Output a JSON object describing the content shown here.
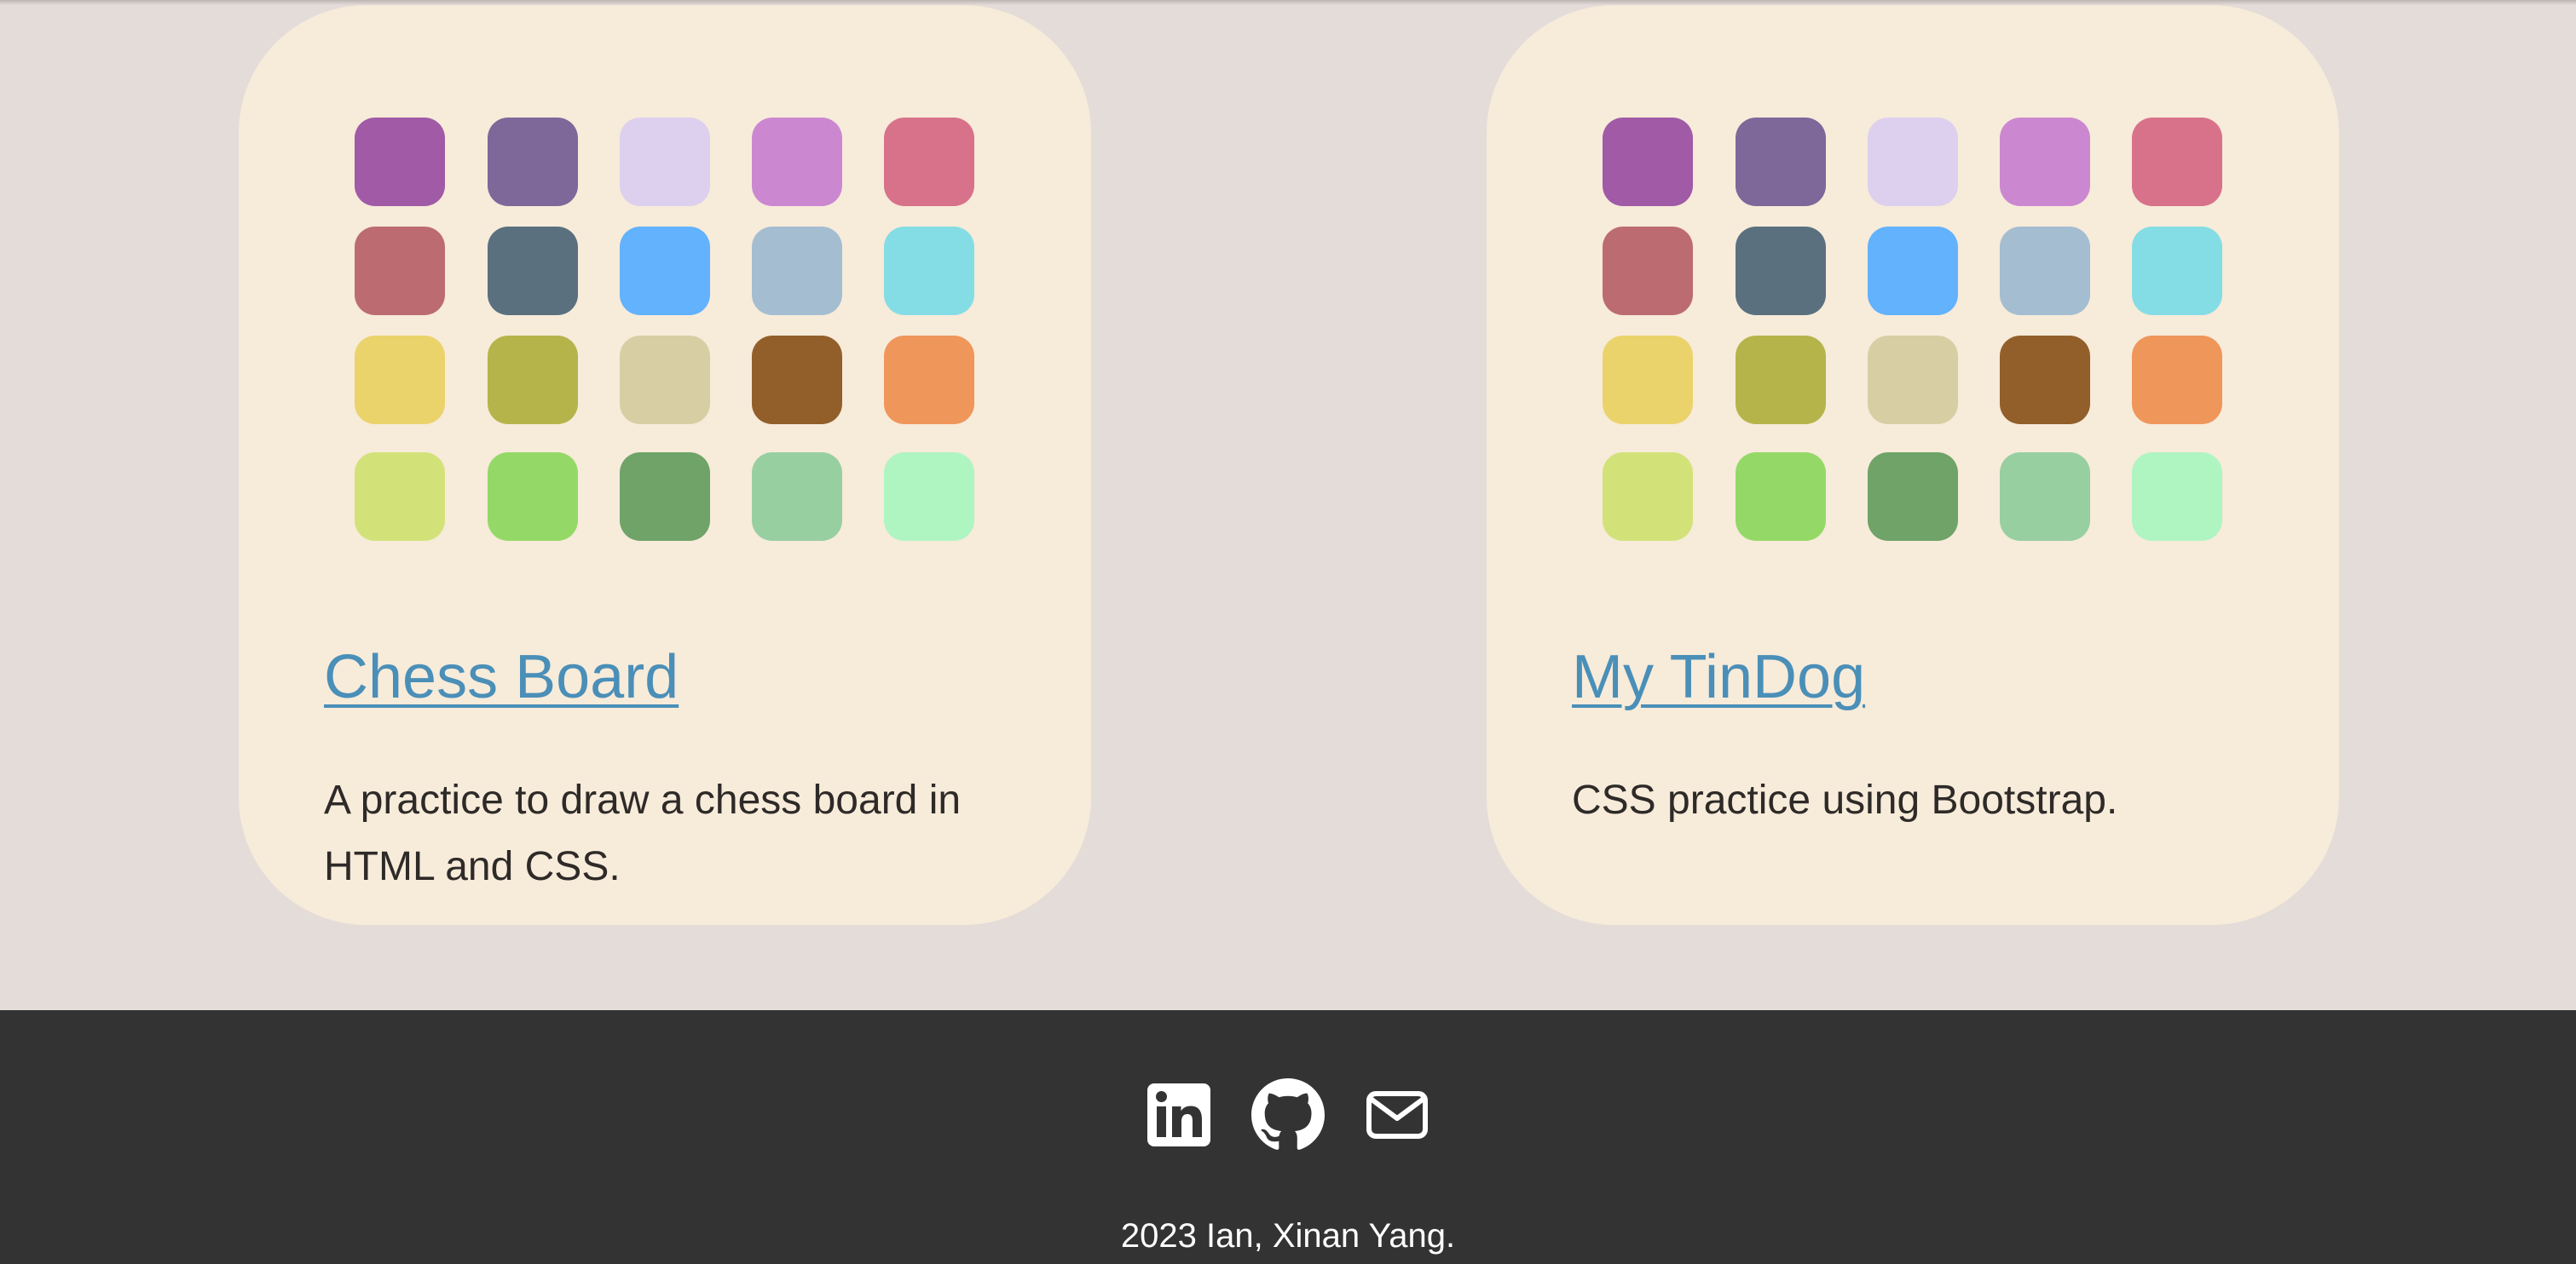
{
  "palette": [
    "#a05aa6",
    "#7d6899",
    "#ddd0ef",
    "#cb88d0",
    "#d8728b",
    "#bc6c70",
    "#5a707f",
    "#62b2fd",
    "#a4bdd1",
    "#84dde5",
    "#ebd36b",
    "#b5b44b",
    "#d7cfa3",
    "#925f2a",
    "#ef965a",
    "#d2e278",
    "#94d968",
    "#6fa368",
    "#98cfa1",
    "#aff5c1"
  ],
  "projects": [
    {
      "title": "Chess Board",
      "description": "A practice to draw a chess board in HTML and CSS."
    },
    {
      "title": "My TinDog",
      "description": "CSS practice using Bootstrap."
    }
  ],
  "footer": {
    "social_icons": [
      "linkedin-icon",
      "github-icon",
      "mail-icon"
    ],
    "copyright": "2023 Ian, Xinan Yang."
  },
  "colors": {
    "page_bg": "#e4dcd8",
    "card_bg": "#f7ebda",
    "link": "#4a8fb8",
    "footer_bg": "#333333"
  }
}
